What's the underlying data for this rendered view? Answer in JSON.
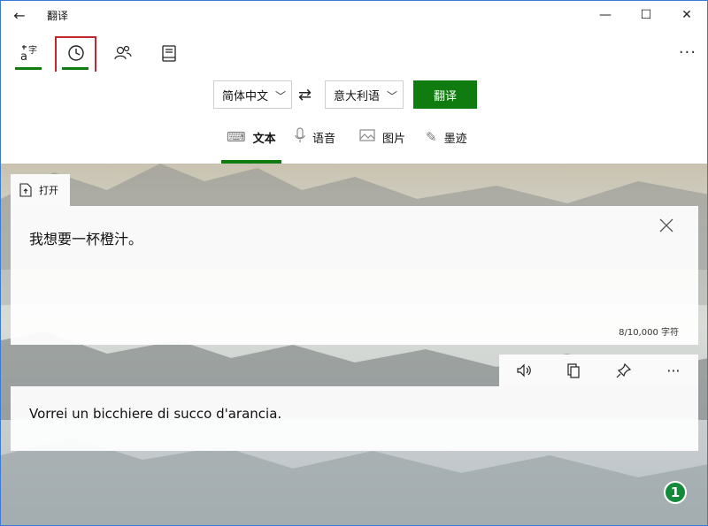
{
  "window": {
    "title": "翻译"
  },
  "titlebar": {
    "back_icon": "back-arrow-icon",
    "controls": {
      "minimize": "—",
      "maximize": "☐",
      "close": "✕"
    }
  },
  "topnav": {
    "items": [
      {
        "name": "translate",
        "icon": "translate-icon",
        "active": true
      },
      {
        "name": "history",
        "icon": "history-clock-icon",
        "highlighted": true
      },
      {
        "name": "conversation",
        "icon": "people-icon"
      },
      {
        "name": "phrasebook",
        "icon": "book-icon"
      }
    ],
    "more_label": "···"
  },
  "langbar": {
    "source_language": "简体中文",
    "target_language": "意大利语",
    "swap_icon": "⇄",
    "translate_label": "翻译"
  },
  "modes": [
    {
      "label": "文本",
      "icon": "⌨",
      "active": true
    },
    {
      "label": "语音",
      "icon": "🎙"
    },
    {
      "label": "图片",
      "icon": "🖼"
    },
    {
      "label": "墨迹",
      "icon": "✎"
    }
  ],
  "open_tab": {
    "label": "打开"
  },
  "source": {
    "text": "我想要一杯橙汁。",
    "char_count": "8/10,000 字符"
  },
  "actions": {
    "speak_icon": "speaker-icon",
    "copy_icon": "copy-icon",
    "pin_icon": "pin-icon",
    "more_label": "···"
  },
  "target": {
    "text": "Vorrei un bicchiere di succo d'arancia."
  },
  "annotation": {
    "marker": "1"
  },
  "colors": {
    "accent": "#107c10",
    "highlight_border": "#c0282d",
    "marker": "#128a3a"
  }
}
